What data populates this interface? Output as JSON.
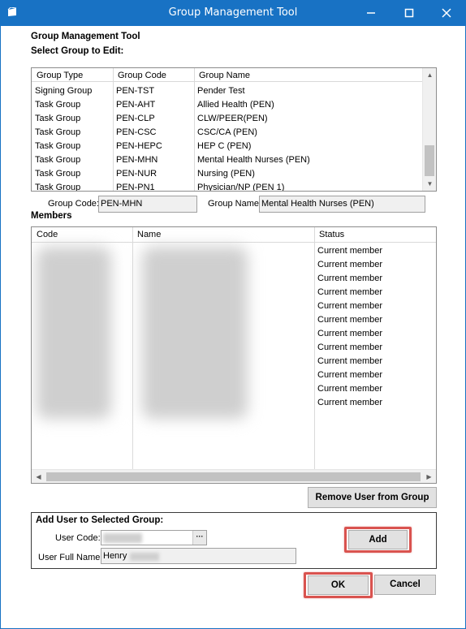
{
  "window": {
    "title": "Group Management Tool",
    "minimize_glyph": "—",
    "maximize_glyph": "☐",
    "close_glyph": "✕",
    "border_color": "#1872c4"
  },
  "header": {
    "title": "Group Management Tool",
    "subtitle": "Select Group to Edit:"
  },
  "groups_table": {
    "columns": [
      "Group Type",
      "Group Code",
      "Group Name"
    ],
    "rows": [
      [
        "Signing Group",
        "PEN-TST",
        "Pender Test"
      ],
      [
        "Task Group",
        "PEN-AHT",
        "Allied Health (PEN)"
      ],
      [
        "Task Group",
        "PEN-CLP",
        "CLW/PEER(PEN)"
      ],
      [
        "Task Group",
        "PEN-CSC",
        "CSC/CA (PEN)"
      ],
      [
        "Task Group",
        "PEN-HEPC",
        "HEP C (PEN)"
      ],
      [
        "Task Group",
        "PEN-MHN",
        "Mental Health Nurses (PEN)"
      ],
      [
        "Task Group",
        "PEN-NUR",
        "Nursing (PEN)"
      ],
      [
        "Task Group",
        "PEN-PN1",
        "Physician/NP (PEN 1)"
      ]
    ]
  },
  "selected_group": {
    "code_label": "Group Code:",
    "code_value": "PEN-MHN",
    "name_label": "Group Name:",
    "name_value": "Mental Health Nurses (PEN)"
  },
  "members": {
    "heading": "Members",
    "columns": [
      "Code",
      "Name",
      "Status"
    ],
    "statuses": [
      "Current member",
      "Current member",
      "Current member",
      "Current member",
      "Current member",
      "Current member",
      "Current member",
      "Current member",
      "Current member",
      "Current member",
      "Current member",
      "Current member"
    ]
  },
  "buttons": {
    "remove_user": "Remove User from Group",
    "add": "Add",
    "ok": "OK",
    "cancel": "Cancel",
    "browse": "···"
  },
  "add_user": {
    "heading": "Add User to Selected Group:",
    "user_code_label": "User Code:",
    "user_full_name_label": "User Full Name:",
    "user_full_name_value": "Henry"
  },
  "colors": {
    "titlebar": "#1872c4",
    "highlight": "#d9534f"
  }
}
